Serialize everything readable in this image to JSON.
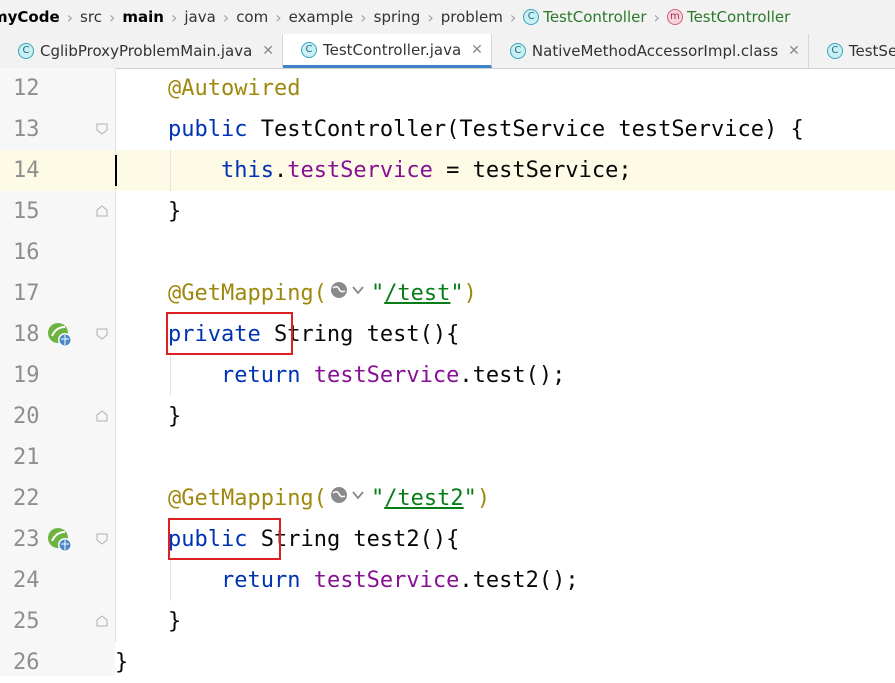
{
  "breadcrumb": {
    "items": [
      "myCode",
      "src",
      "main",
      "java",
      "com",
      "example",
      "spring",
      "problem",
      "TestController",
      "TestController"
    ]
  },
  "tabs": [
    {
      "label": "CglibProxyProblemMain.java"
    },
    {
      "label": "TestController.java"
    },
    {
      "label": "NativeMethodAccessorImpl.class"
    },
    {
      "label": "TestServic"
    }
  ],
  "editor": {
    "line_numbers": [
      "12",
      "13",
      "14",
      "15",
      "16",
      "17",
      "18",
      "19",
      "20",
      "21",
      "22",
      "23",
      "24",
      "25",
      "26"
    ],
    "tokens": {
      "autowired": "@Autowired",
      "public": "public",
      "ctor_sig": " TestController(TestService testService) {",
      "this": "this",
      "dot_field": ".",
      "field": "testService",
      "assign": " = testService;",
      "rbrace": "}",
      "getmapping": "@GetMapping(",
      "q": "\"",
      "path1": "/test",
      "close_paren": ")",
      "private": "private",
      "test_sig": " String test(){",
      "return": "return",
      "call1": ".test();",
      "path2": "/test2",
      "test2_sig": " String test2(){",
      "call2": ".test2();"
    }
  },
  "icons": [
    "class-icon",
    "method-icon",
    "close-icon",
    "spring-bean-icon",
    "globe-icon",
    "fold-icon"
  ]
}
